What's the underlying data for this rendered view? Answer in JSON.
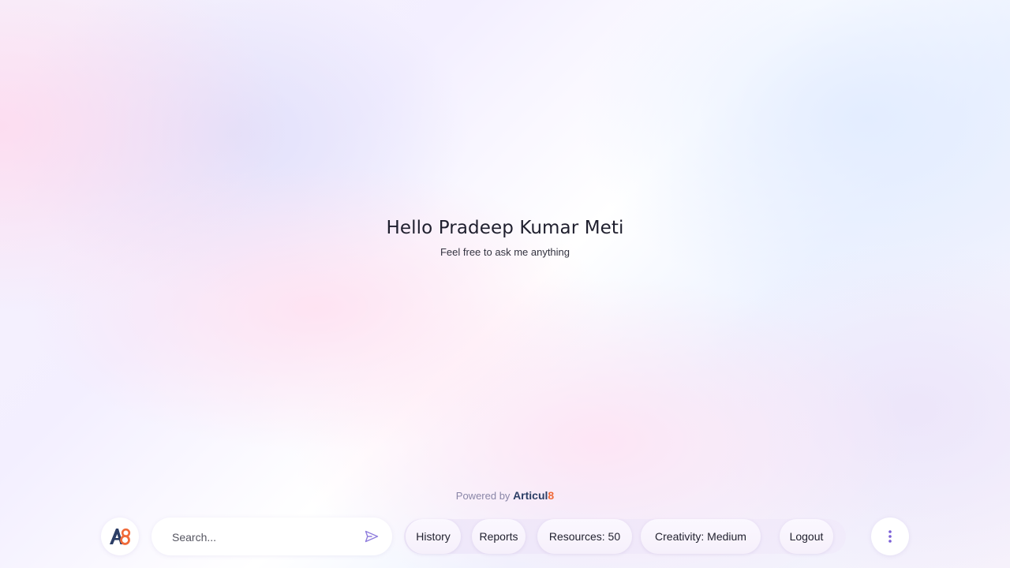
{
  "greeting": {
    "title": "Hello Pradeep Kumar Meti",
    "subtitle": "Feel free to ask me anything"
  },
  "footer": {
    "powered_by_label": "Powered by",
    "brand_main": "Articul",
    "brand_accent": "8"
  },
  "toolbar": {
    "logo_icon": "articul8-logo-icon",
    "search": {
      "placeholder": "Search...",
      "value": "",
      "send_icon": "send-icon"
    },
    "pills": {
      "history": "History",
      "reports": "Reports",
      "resources": "Resources: 50",
      "creativity": "Creativity: Medium",
      "logout": "Logout"
    },
    "more_icon": "more-vertical-icon"
  },
  "colors": {
    "brand_navy": "#2c3e66",
    "brand_orange": "#f06b3a",
    "accent_purple": "#7b5fd6"
  }
}
